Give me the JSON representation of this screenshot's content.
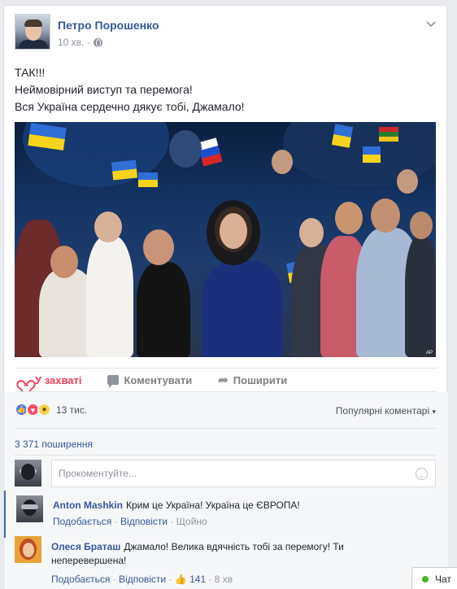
{
  "post": {
    "author": "Петро Порошенко",
    "time": "10 хв.",
    "separator": "·",
    "lines": [
      "ТАК!!!",
      "Неймовірний виступ та перемога!",
      "Вся Україна сердечно дякує тобі, Джамало!"
    ],
    "photo_credit": "AP"
  },
  "actions": {
    "like": "У захваті",
    "comment": "Коментувати",
    "share": "Поширити"
  },
  "reactions": {
    "count": "13 тис.",
    "sort_label": "Популярні коментарі",
    "sort_caret": "▾"
  },
  "shares": "3 371 поширення",
  "composer": {
    "placeholder": "Прокоментуйте..."
  },
  "comments": [
    {
      "author": "Anton Mashkin",
      "text": "Крим це Україна! Україна це ЄВРОПА!",
      "like": "Подобається",
      "reply": "Відповісти",
      "time": "Щойно"
    },
    {
      "author": "Олеся Браташ",
      "text": "Джамало! Велика вдячність тобі за перемогу! Ти неперевершена!",
      "like": "Подобається",
      "reply": "Відповісти",
      "likes": "141",
      "time": "8 хв"
    }
  ],
  "chat": {
    "label": "Чат"
  },
  "colors": {
    "link": "#365899",
    "love": "#f33e58",
    "like": "#4080ff"
  },
  "icons": [
    "globe-icon",
    "chevron-down-icon",
    "heart-icon",
    "comment-icon",
    "share-icon",
    "like-reaction-icon",
    "love-reaction-icon",
    "wow-reaction-icon",
    "smiley-icon",
    "thumbs-up-icon"
  ]
}
